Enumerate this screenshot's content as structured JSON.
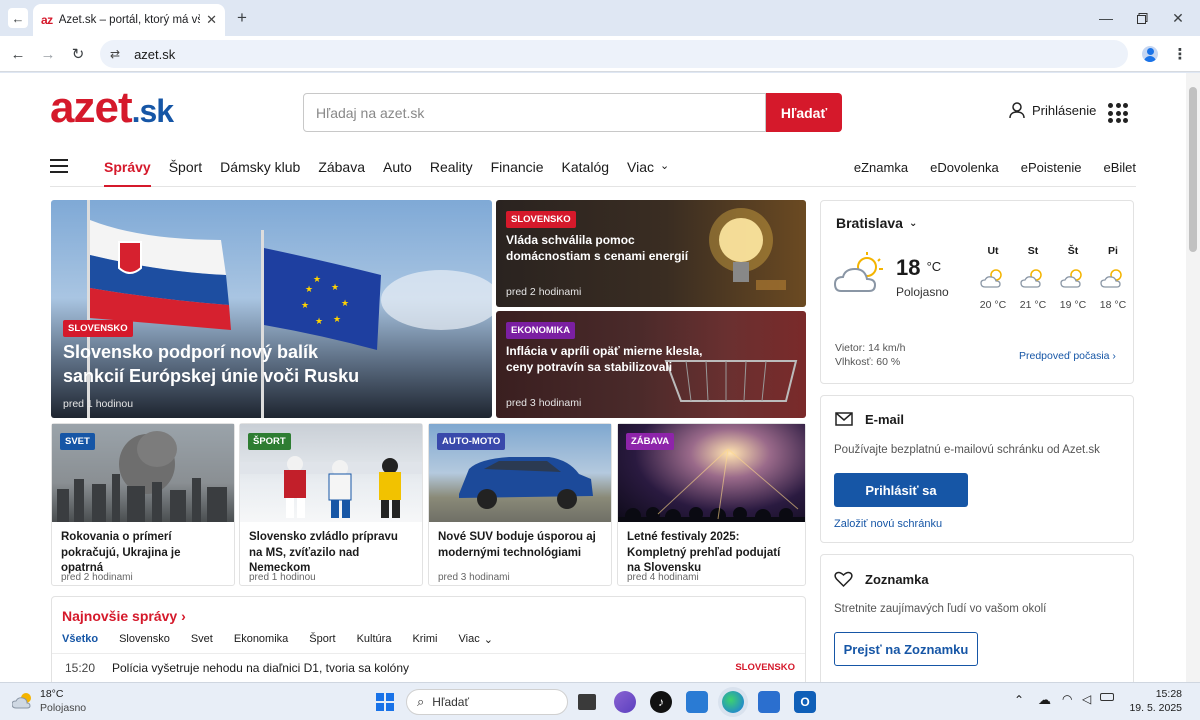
{
  "browser": {
    "tab_title": "Azet.sk – portál, ktorý má všetko",
    "tab_favicon": "az",
    "url": "azet.sk"
  },
  "header": {
    "logo_main": "azet",
    "logo_tld": ".sk",
    "search_placeholder": "Hľadaj na azet.sk",
    "search_button": "Hľadať",
    "login": "Prihlásenie"
  },
  "nav": {
    "items": [
      "Správy",
      "Šport",
      "Dámsky klub",
      "Zábava",
      "Auto",
      "Reality",
      "Financie",
      "Katalóg",
      "Viac"
    ],
    "active": "Správy",
    "right": [
      "eZnamka",
      "eDovolenka",
      "ePoistenie",
      "eBilet"
    ]
  },
  "hero": {
    "category": "SLOVENSKO",
    "title": "Slovensko podporí nový balík sankcií Európskej únie voči Rusku",
    "time": "pred 1 hodinou"
  },
  "side_stories": [
    {
      "category": "SLOVENSKO",
      "title": "Vláda schválila pomoc domácnostiam s cenami energií",
      "time": "pred 2 hodinami"
    },
    {
      "category": "EKONOMIKA",
      "title": "Inflácia v apríli opäť mierne klesla, ceny potravín sa stabilizovali",
      "time": "pred 3 hodinami"
    }
  ],
  "small_stories": [
    {
      "category": "SVET",
      "title": "Rokovania o prímerí pokračujú, Ukrajina je opatrná",
      "time": "pred 2 hodinami"
    },
    {
      "category": "ŠPORT",
      "title": "Slovensko zvládlo prípravu na MS, zvíťazilo nad Nemeckom",
      "time": "pred 1 hodinou"
    },
    {
      "category": "AUTO-MOTO",
      "title": "Nové SUV boduje úsporou aj modernými technológiami",
      "time": "pred 3 hodinami"
    },
    {
      "category": "ZÁBAVA",
      "title": "Letné festivaly 2025: Kompletný prehľad podujatí na Slovensku",
      "time": "pred 4 hodinami"
    }
  ],
  "latest": {
    "title": "Najnovšie správy",
    "tabs": [
      "Všetko",
      "Slovensko",
      "Svet",
      "Ekonomika",
      "Šport",
      "Kultúra",
      "Krimi",
      "Viac"
    ],
    "active_tab": "Všetko",
    "items": [
      {
        "time": "15:20",
        "title": "Polícia vyšetruje nehodu na diaľnici D1, tvoria sa kolóny",
        "category": "SLOVENSKO"
      }
    ]
  },
  "weather": {
    "city": "Bratislava",
    "temp": "18",
    "unit": "°C",
    "condition": "Polojasno",
    "wind": "Vietor: 14 km/h",
    "humidity": "Vlhkosť: 60 %",
    "forecast_link": "Predpoveď počasia",
    "days": [
      {
        "day": "Ut",
        "temp": "20 °C"
      },
      {
        "day": "St",
        "temp": "21 °C"
      },
      {
        "day": "Št",
        "temp": "19 °C"
      },
      {
        "day": "Pi",
        "temp": "18 °C"
      }
    ]
  },
  "email": {
    "title": "E-mail",
    "text": "Používajte bezplatnú e-mailovú schránku od Azet.sk",
    "button": "Prihlásiť sa",
    "link": "Založiť novú schránku"
  },
  "dating": {
    "title": "Zoznamka",
    "text": "Stretnite zaujímavých ľudí vo vašom okolí",
    "button": "Prejsť na Zoznamku"
  },
  "taskbar": {
    "weather_temp": "18°C",
    "weather_text": "Polojasno",
    "search": "Hľadať",
    "time": "15:28",
    "date": "19. 5. 2025"
  },
  "colors": {
    "brand_red": "#d5192b",
    "brand_blue": "#1656a6"
  }
}
